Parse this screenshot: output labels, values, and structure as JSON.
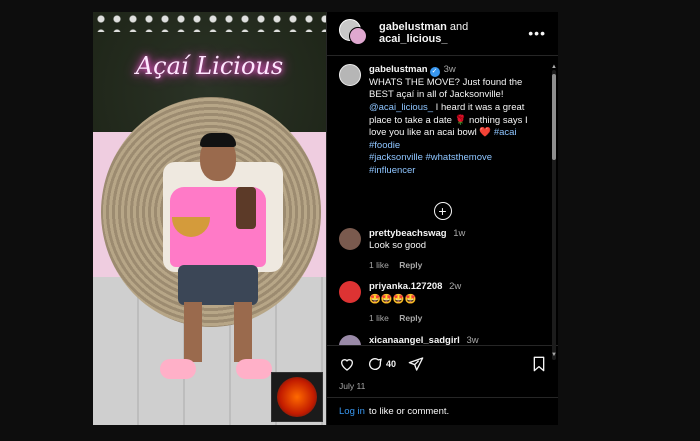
{
  "header": {
    "user1": "gabelustman",
    "and_text": "and",
    "user2": "acai_licious_",
    "more_label": "•••"
  },
  "media": {
    "neon_sign": "Açaí Licious"
  },
  "caption": {
    "username": "gabelustman",
    "time": "3w",
    "text_1": "WHATS THE MOVE? Just found the BEST açaí in all of Jacksonville! ",
    "mention": "@acai_licious_",
    "text_2": " I heard it was a great place to take a date ",
    "rose": "🌹",
    "text_3": " nothing says I love you like an acai bowl ",
    "heart": "❤️",
    "hashtags_1": " #acai #foodie",
    "hashtags_2": "#jacksonville #whatsthemove",
    "hashtags_3": "#influencer"
  },
  "comments": [
    {
      "username": "prettybeachswag",
      "time": "1w",
      "text": "Look so good",
      "likes": "1 like",
      "reply": "Reply",
      "avatar_color": "#7a5a4e"
    },
    {
      "username": "priyanka.127208",
      "time": "2w",
      "text": "🤩🤩🤩🤩",
      "likes": "1 like",
      "reply": "Reply",
      "avatar_color": "#d33"
    },
    {
      "username": "xicanaangel_sadgirl",
      "time": "3w",
      "text": "",
      "likes": "",
      "reply": "",
      "avatar_color": "#9a8aa8"
    }
  ],
  "actions": {
    "comment_count": "40",
    "date": "July 11"
  },
  "login": {
    "link": "Log in",
    "text": "to like or comment."
  }
}
